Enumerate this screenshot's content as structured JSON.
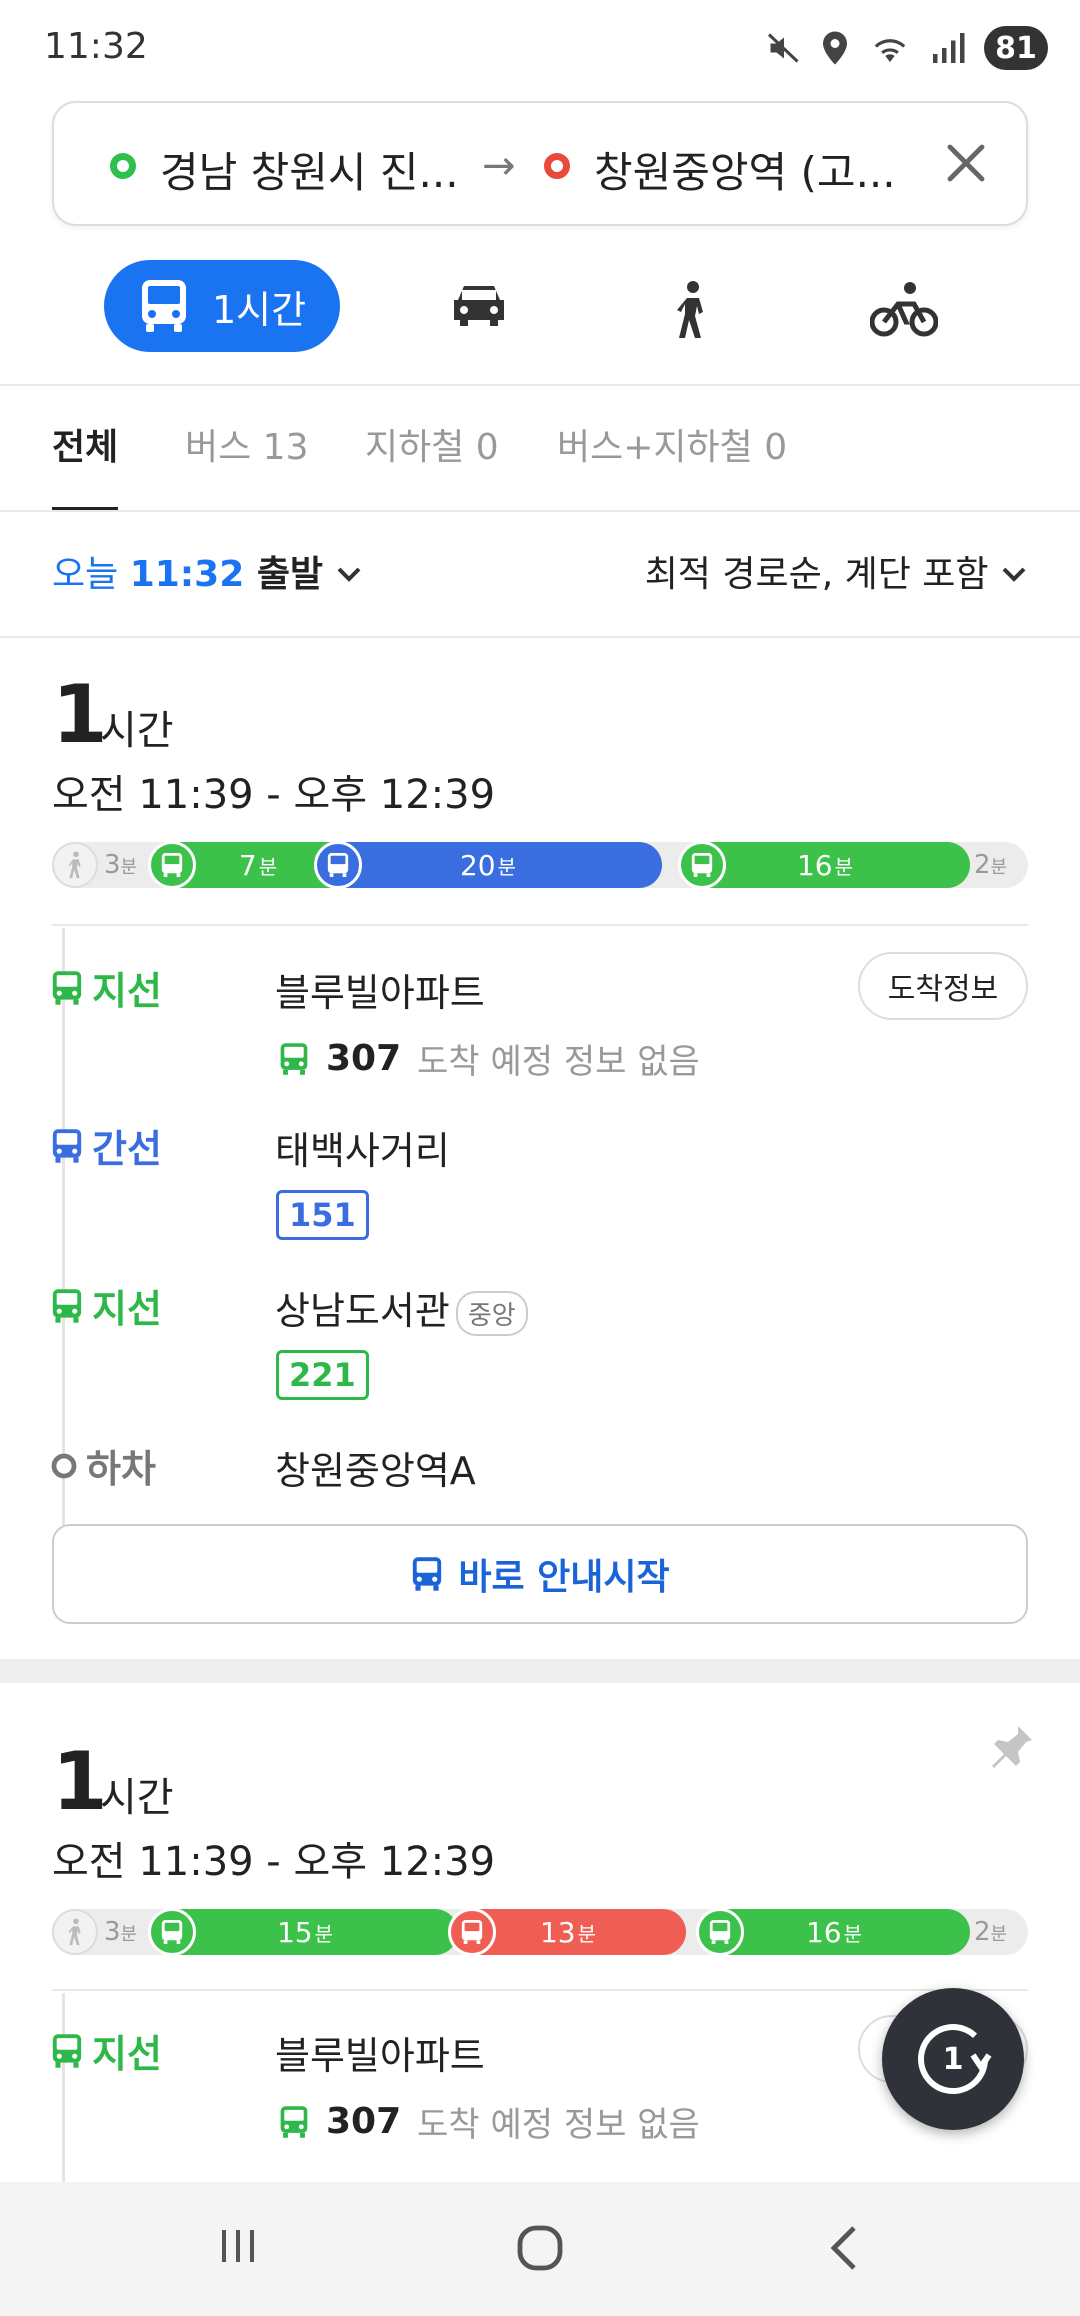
{
  "status_bar": {
    "time": "11:32",
    "battery": "81"
  },
  "route": {
    "origin": "경남 창원시 진...",
    "arrow": "→",
    "destination": "창원중앙역 (고..."
  },
  "modes": {
    "transit_label": "1시간"
  },
  "filter_tabs": [
    {
      "label": "전체"
    },
    {
      "label": "버스 13"
    },
    {
      "label": "지하철 0"
    },
    {
      "label": "버스+지하철 0"
    }
  ],
  "departure": {
    "prefix": "오늘 ",
    "time": "11:32",
    "suffix": " 출발",
    "sort": "최적 경로순, 계단 포함"
  },
  "routes": [
    {
      "duration_num": "1",
      "duration_unit": "시간",
      "time_range": "오전 11:39 - 오후 12:39",
      "timeline": {
        "walk_start": "3",
        "walk_end": "2",
        "unit": "분",
        "segments": [
          {
            "color": "#3cc24a",
            "minutes": "7"
          },
          {
            "color": "#3a6de0",
            "minutes": "20"
          },
          {
            "color": "#3cc24a",
            "minutes": "16"
          }
        ]
      },
      "steps": [
        {
          "type": "지선",
          "stop": "블루빌아파트",
          "bus": "307",
          "bus_info": "도착 예정 정보 없음",
          "arrival_btn": "도착정보"
        },
        {
          "type": "간선",
          "stop": "태백사거리",
          "bus": "151"
        },
        {
          "type": "지선",
          "stop": "상남도서관",
          "stop_tag": "중앙",
          "bus": "221"
        },
        {
          "type": "하차",
          "stop": "창원중앙역A"
        }
      ],
      "start_button": "바로 안내시작"
    },
    {
      "duration_num": "1",
      "duration_unit": "시간",
      "time_range": "오전 11:39 - 오후 12:39",
      "timeline": {
        "walk_start": "3",
        "walk_end": "2",
        "unit": "분",
        "segments": [
          {
            "color": "#3cc24a",
            "minutes": "15"
          },
          {
            "color": "#f05d52",
            "minutes": "13"
          },
          {
            "color": "#3cc24a",
            "minutes": "16"
          }
        ]
      },
      "steps": [
        {
          "type": "지선",
          "stop": "블루빌아파트",
          "bus": "307",
          "bus_info": "도착 예정 정보 없음"
        }
      ]
    }
  ],
  "refresh_fab": {
    "count": "1"
  },
  "colors": {
    "accent": "#1a73f0",
    "branch_bus": "#3cc24a",
    "trunk_bus": "#3a6de0",
    "express_bus": "#f05d52"
  }
}
